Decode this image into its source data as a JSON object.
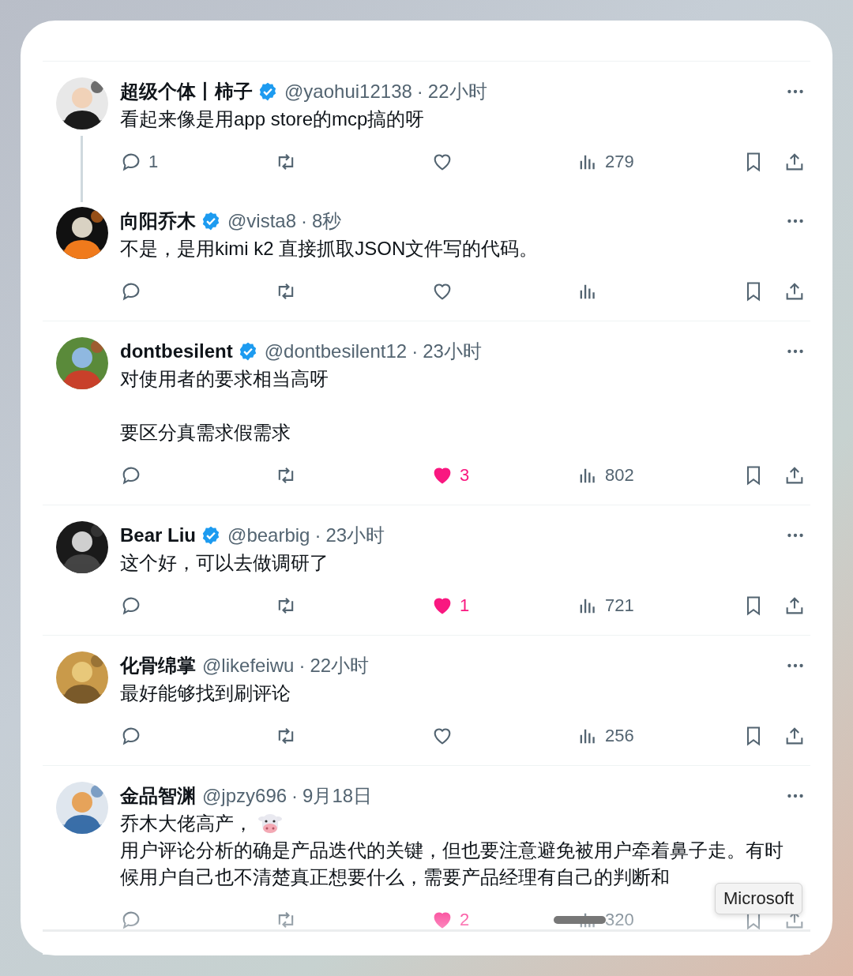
{
  "posts": [
    {
      "name": "超级个体丨柿子",
      "verified": true,
      "handle": "@yaohui12138",
      "separator": "·",
      "time": "22小时",
      "thread": true,
      "paragraphs": [
        {
          "text": "看起来像是用app store的mcp搞的呀"
        }
      ],
      "replies": "1",
      "liked": false,
      "views": "279"
    },
    {
      "name": "向阳乔木",
      "verified": true,
      "handle": "@vista8",
      "separator": "·",
      "time": "8秒",
      "paragraphs": [
        {
          "text": "不是，是用kimi k2 直接抓取JSON文件写的代码。"
        }
      ],
      "liked": false
    },
    {
      "name": "dontbesilent",
      "verified": true,
      "handle": "@dontbesilent12",
      "separator": "·",
      "time": "23小时",
      "paragraphs": [
        {
          "text": "对使用者的要求相当高呀"
        },
        {
          "text": "要区分真需求假需求",
          "blank_line_before": true
        }
      ],
      "likes": "3",
      "liked": true,
      "views": "802"
    },
    {
      "name": "Bear Liu",
      "verified": true,
      "handle": "@bearbig",
      "separator": "·",
      "time": "23小时",
      "paragraphs": [
        {
          "text": "这个好，可以去做调研了"
        }
      ],
      "likes": "1",
      "liked": true,
      "views": "721"
    },
    {
      "name": "化骨绵掌",
      "handle": "@likefeiwu",
      "separator": "·",
      "time": "22小时",
      "paragraphs": [
        {
          "text": "最好能够找到刷评论"
        }
      ],
      "liked": false,
      "views": "256"
    },
    {
      "name": "金品智渊",
      "handle": "@jpzy696",
      "separator": "·",
      "time": "9月18日",
      "paragraphs": [
        {
          "text": "乔木大佬高产，",
          "emoji": true
        },
        {
          "text": "用户评论分析的确是产品迭代的关键，但也要注意避免被用户牵着鼻子走。有时候用户自己也不清楚真正想要什么，需要产品经理有自己的判断和"
        }
      ],
      "likes": "2",
      "liked": true,
      "views": "320"
    }
  ],
  "tooltip": "Microsoft"
}
